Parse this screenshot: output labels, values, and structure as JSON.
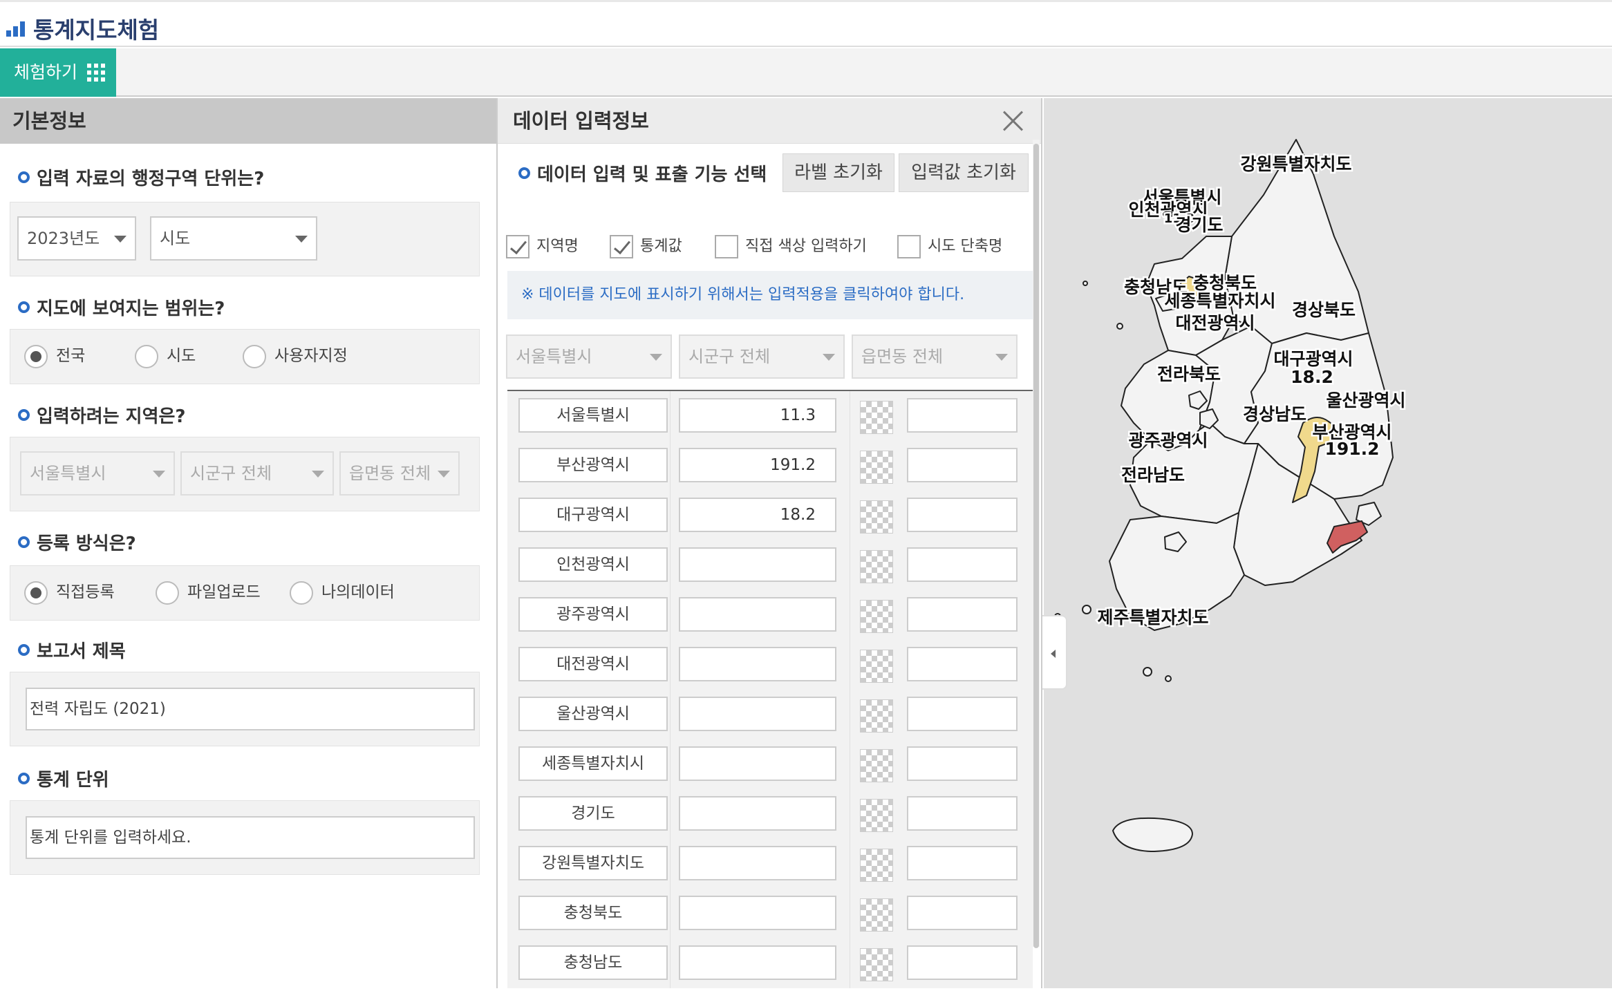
{
  "header": {
    "title": "통계지도체험"
  },
  "menu": {
    "try_label": "체험하기"
  },
  "left_panel": {
    "title": "기본정보",
    "q_admin_unit": "입력 자료의 행정구역 단위는?",
    "year_select": "2023년도",
    "unit_select": "시도",
    "q_map_range": "지도에 보여지는 범위는?",
    "range_options": [
      "전국",
      "시도",
      "사용자지정"
    ],
    "range_selected": "전국",
    "q_region": "입력하려는 지역은?",
    "region_selects": [
      "서울특별시",
      "시군구 전체",
      "읍면동 전체"
    ],
    "q_register": "등록 방식은?",
    "register_options": [
      "직접등록",
      "파일업로드",
      "나의데이터"
    ],
    "register_selected": "직접등록",
    "q_report_title": "보고서 제목",
    "report_title_value": "전력 자립도 (2021)",
    "q_stat_unit": "통계 단위",
    "stat_unit_placeholder": "통계 단위를 입력하세요."
  },
  "data_panel": {
    "title": "데이터 입력정보",
    "func_label": "데이터 입력 및 표출 기능 선택",
    "reset_label_btn": "라벨 초기화",
    "reset_input_btn": "입력값 초기화",
    "checkboxes": [
      {
        "label": "지역명",
        "checked": true
      },
      {
        "label": "통계값",
        "checked": true
      },
      {
        "label": "직접 색상 입력하기",
        "checked": false
      },
      {
        "label": "시도 단축명",
        "checked": false
      }
    ],
    "notice": "※ 데이터를 지도에 표시하기 위해서는 입력적용을 클릭하여야 합니다.",
    "filters": [
      "서울특별시",
      "시군구 전체",
      "읍면동 전체"
    ],
    "rows": [
      {
        "name": "서울특별시",
        "value": "11.3"
      },
      {
        "name": "부산광역시",
        "value": "191.2"
      },
      {
        "name": "대구광역시",
        "value": "18.2"
      },
      {
        "name": "인천광역시",
        "value": ""
      },
      {
        "name": "광주광역시",
        "value": ""
      },
      {
        "name": "대전광역시",
        "value": ""
      },
      {
        "name": "울산광역시",
        "value": ""
      },
      {
        "name": "세종특별자치시",
        "value": ""
      },
      {
        "name": "경기도",
        "value": ""
      },
      {
        "name": "강원특별자치도",
        "value": ""
      },
      {
        "name": "충청북도",
        "value": ""
      },
      {
        "name": "충청남도",
        "value": ""
      }
    ]
  },
  "map": {
    "labels": {
      "gangwon": "강원특별자치도",
      "seoul": "서울특별시",
      "seoul_val": "11.3",
      "incheon": "인천광역시",
      "gyeonggi": "경기도",
      "chungnam": "충청남도",
      "chungbuk": "충청북도",
      "sejong": "세종특별자치시",
      "daejeon": "대전광역시",
      "gyeongbuk": "경상북도",
      "daegu": "대구광역시",
      "daegu_val": "18.2",
      "jeonbuk": "전라북도",
      "ulsan": "울산광역시",
      "gyeongnam": "경상남도",
      "busan": "부산광역시",
      "busan_val": "191.2",
      "gwangju": "광주광역시",
      "jeonnam": "전라남도",
      "jeju": "제주특별자치도"
    },
    "colors": {
      "low": "#f0d98c",
      "high": "#d06060",
      "base": "#f3f3f3",
      "border": "#222222"
    }
  }
}
